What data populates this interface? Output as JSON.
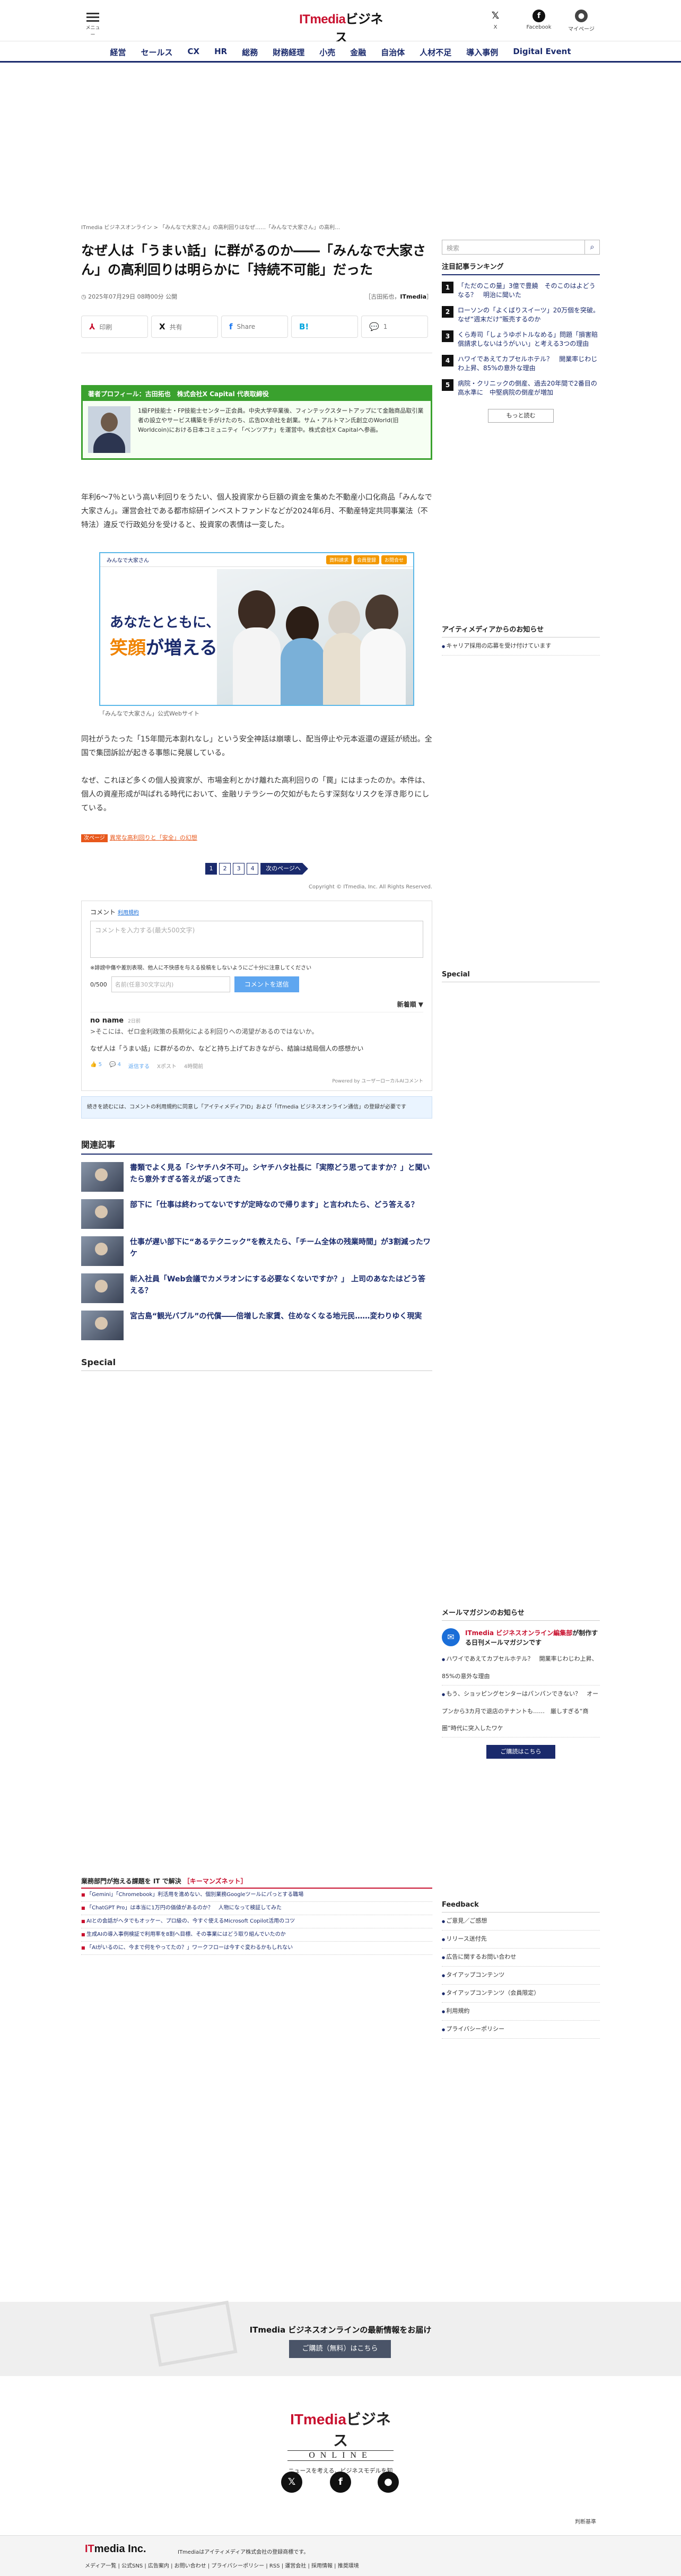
{
  "header": {
    "menu_label": "メニュー",
    "logo_top_a": "ITmedia",
    "logo_top_b": "ビジネス",
    "logo_bottom": "ONLINE",
    "x_label": "X",
    "facebook_label": "Facebook",
    "mypage_label": "マイページ"
  },
  "nav": [
    "経営",
    "セールス",
    "CX",
    "HR",
    "総務",
    "財務経理",
    "小売",
    "金融",
    "自治体",
    "人材不足",
    "導入事例",
    "Digital Event"
  ],
  "article": {
    "breadcrumb": "ITmedia ビジネスオンライン > 「みんなで大家さん」の高利回りはなぜ……「みんなで大家さん」の高利…",
    "title": "なぜ人は「うまい話」に群がるのか――「みんなで大家さん」の高利回りは明らかに「持続不可能」だった",
    "date": "2025年07月29日 08時00分 公開",
    "byline": "［古田拓也，",
    "byline_source": "ITmedia",
    "byline_end": "］",
    "share": [
      {
        "icon": "pdf-icon",
        "glyph": "⅄",
        "label": "印刷",
        "color": "#c8102e"
      },
      {
        "icon": "x-icon",
        "glyph": "X",
        "label": "共有",
        "color": "#111"
      },
      {
        "icon": "facebook-icon",
        "glyph": "f",
        "label": "Share",
        "color": "#1877f2"
      },
      {
        "icon": "hatena-icon",
        "glyph": "B!",
        "label": "",
        "color": "#00a4de"
      },
      {
        "icon": "comment-icon",
        "glyph": "💬",
        "label": "1",
        "color": "#555"
      }
    ],
    "profile_head": "著者プロフィール：古田拓也　株式会社X Capital 代表取締役",
    "profile_text": "1級FP技能士・FP技能士センター正会員。中央大学卒業後、フィンテックスタートアップにて金融商品取引業者の設立やサービス構築を手がけたのち、広告DX会社を創業。サム・アルトマン氏創立のWorld(旧Worldcoin)における日本コミュニティ「ベンツアナ」を運営中。株式会社X Capitalへ参画。",
    "p1": "年利6〜7％という高い利回りをうたい、個人投資家から巨額の資金を集めた不動産小口化商品「みんなで大家さん」。運営会社である都市綜研インベストファンドなどが2024年6月、不動産特定共同事業法（不特法）違反で行政処分を受けると、投資家の表情は一変した。",
    "figure_header_left": "みんなで大家さん",
    "figure_pills": [
      "資料請求",
      "会員登録",
      "お問合せ"
    ],
    "figure_copy1": "あなたとともに、",
    "figure_copy2a": "笑顔",
    "figure_copy2b": "が増える",
    "caption": "「みんなで大家さん」公式Webサイト",
    "p2": "同社がうたった「15年間元本割れなし」という安全神話は崩壊し、配当停止や元本返還の遅延が続出。全国で集団訴訟が起きる事態に発展している。",
    "p3": "なぜ、これほど多くの個人投資家が、市場金利とかけ離れた高利回りの「罠」にはまったのか。本件は、個人の資産形成が叫ばれる時代において、金融リテラシーの欠如がもたらす深刻なリスクを浮き彫りにしている。",
    "next_tag": "次ページ",
    "next_text": "異常な高利回りと「安全」の幻想",
    "pages": [
      "1",
      "2",
      "3",
      "4"
    ],
    "next_page": "次のページへ",
    "copyright": "Copyright © ITmedia, Inc. All Rights Reserved."
  },
  "comments": {
    "head": "コメント",
    "terms": "利用規約",
    "placeholder": "コメントを入力する(最大500文字)",
    "notice": "※誹謗中傷や差別表現、他人に不快感を与える投稿をしないようにご十分に注意してください",
    "count": "0/500",
    "name_placeholder": "名前(任意30文字以内)",
    "post": "コメントを送信",
    "sort": "新着順 ▼",
    "user": "no name",
    "time": "2日前",
    "quote": ">そこには、ゼロ金利政策の長期化による利回りへの渇望があるのではないか。",
    "text": "なぜ人は「うまい話」に群がるのか、などと持ち上げておきながら、結論は結局個人の感想かい",
    "like": "5",
    "reply": "4",
    "reply_label": "返信する",
    "x_post": "Xポスト",
    "hide": "4時間前",
    "powered": "Powered by ユーザーローカルAIコメント",
    "note": "続きを読むには、コメントの利用規約に同意し「アイティメディアID」および「ITmedia ビジネスオンライン通信」の登録が必要です"
  },
  "related": {
    "heading": "関連記事",
    "items": [
      "書類でよく見る「シヤチハタ不可」。シヤチハタ社長に「実際どう思ってますか？」と聞いたら意外すぎる答えが返ってきた",
      "部下に「仕事は終わってないですが定時なので帰ります」と言われたら、どう答える？",
      "仕事が遅い部下に“あるテクニック”を教えたら、「チーム全体の残業時間」が3割減ったワケ",
      "新入社員「Web会議でカメラオンにする必要なくないですか？」 上司のあなたはどう答える？",
      "宮古島“観光バブル”の代償――倍増した家賃、住めなくなる地元民……変わりゆく現実"
    ],
    "special": "Special"
  },
  "topics": {
    "heading_a": "業務部門が抱える課題を IT で解決",
    "heading_b": "［キーマンズネット］",
    "items": [
      "「Gemini」「Chromebook」利活用を進めない、個別業務Googleツールにパっとする職場",
      "「ChatGPT Pro」は本当に1万円の価値があるのか？　人物になって検証してみた",
      "AIとの会話がヘタでもオッケー、プロ級の、今すぐ使えるMicrosoft Copilot活用のコツ",
      "生成AIの導入事例検証で利用率を8割へ目標、その事業にはどう取り組んでいたのか",
      "「AIがいるのに、今まで何をやってたの？」ワークフローは今すぐ変わるかもしれない"
    ]
  },
  "side": {
    "search_placeholder": "検索",
    "ranking_head": "注目記事ランキング",
    "ranking": [
      "「ただのこの量」3億で豊饒　そのこのはよどうなる？　明治に聞いた",
      "ローソンの「よくばりスイーツ」20万個を突破。なぜ“週末だけ”販売するのか",
      "くら寿司「しょうゆボトルなめる」問題「損害賠償請求しないはうがいい」と考える3つの理由",
      "ハワイであえてカプセルホテル？　開業率じわじわ上昇、85%の意外な理由",
      "病院・クリニックの倒産、過去20年間で2番目の高水準に　中堅病院の倒産が増加"
    ],
    "more": "もっと読む",
    "from_head": "アイティメディアからのお知らせ",
    "from_items": [
      "キャリア採用の応募を受け付けています"
    ],
    "special": "Special",
    "mail_head": "メールマガジンのお知らせ",
    "mail_title_a": "ITmedia ビジネスオンライン編集部",
    "mail_title_b": "が制作する日刊メールマガジンです",
    "mail_items": [
      "ハワイであえてカプセルホテル？　開業率じわじわ上昇、85%の意外な理由",
      "もう、ショッピングセンターはパンパンできない？　オープンから3カ月で退店のテナントも……　厳しすぎる“商圏”時代に突入したワケ"
    ],
    "mail_button": "ご購読はこちら",
    "feedback_head": "Feedback",
    "feedback": [
      "ご意見／ご感想",
      "リリース送付先",
      "広告に関するお問い合わせ",
      "タイアップコンテンツ",
      "タイアップコンテンツ（会員限定）",
      "利用規約",
      "プライバシーポリシー"
    ]
  },
  "band": {
    "text": "ITmedia ビジネスオンラインの最新情報をお届け",
    "button": "ご購読（無料）はこちら"
  },
  "footer": {
    "tagline": "ニュースを考える、ビジネスモデルを知る",
    "note": "判断基準",
    "corp_a": "IT",
    "corp_b": "media Inc.",
    "desc": "ITmediaはアイティメディア株式会社の登録商標です。",
    "links": "メディア一覧 | 公式SNS | 広告案内 | お問い合わせ | プライバシーポリシー | RSS | 運営会社 | 採用情報 | 推奨環境"
  }
}
